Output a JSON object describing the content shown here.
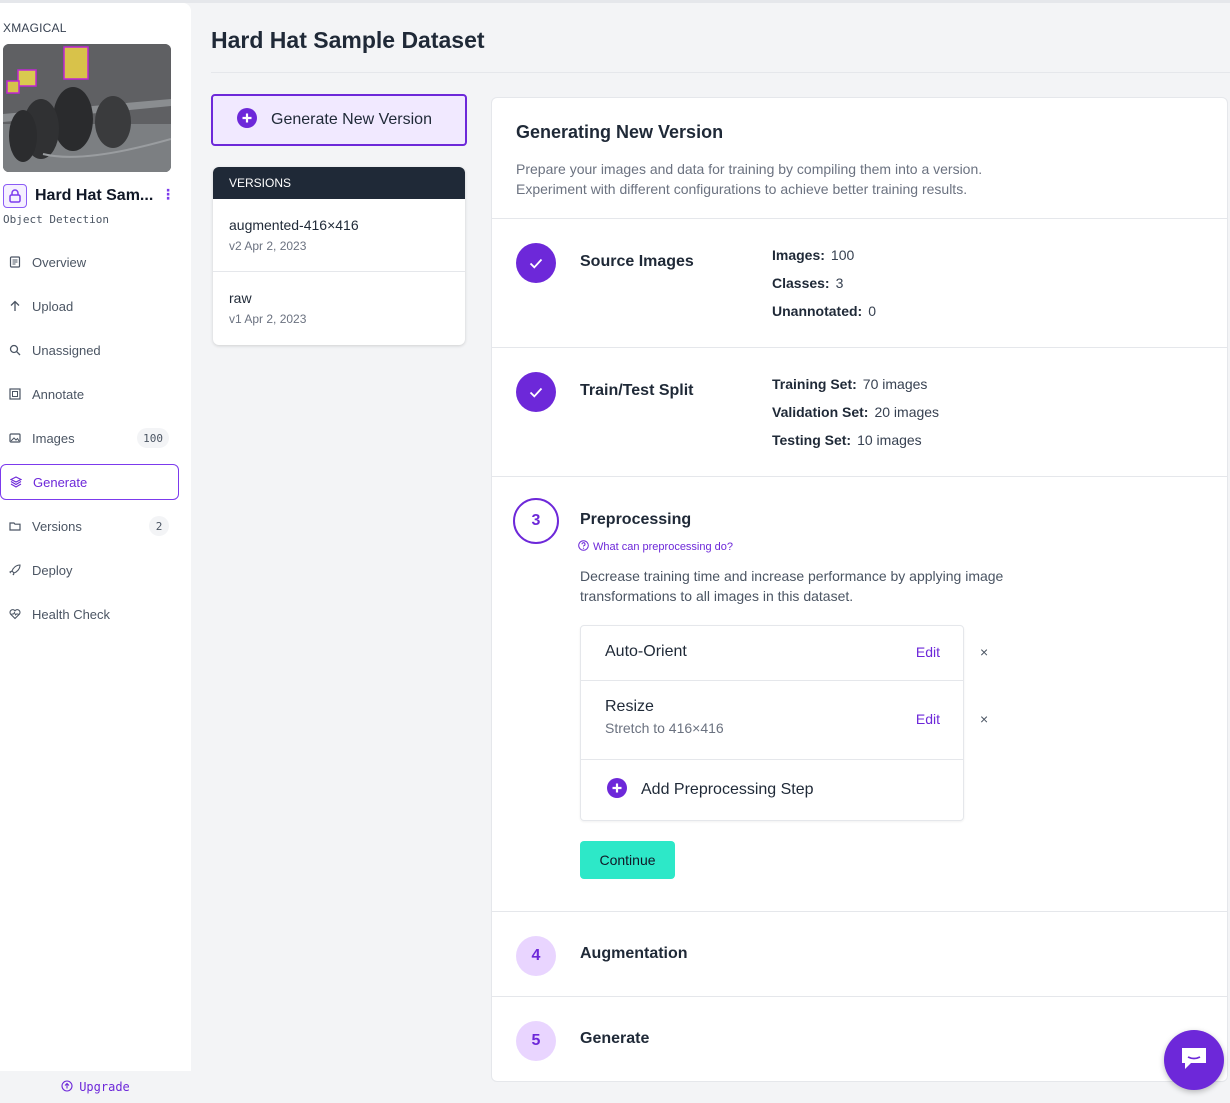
{
  "sidebar": {
    "workspace": "XMAGICAL",
    "project_name": "Hard Hat Sam...",
    "project_type": "Object Detection",
    "items": [
      {
        "label": "Overview",
        "icon": "document-icon"
      },
      {
        "label": "Upload",
        "icon": "arrow-up-icon"
      },
      {
        "label": "Unassigned",
        "icon": "search-icon"
      },
      {
        "label": "Annotate",
        "icon": "annotate-icon"
      },
      {
        "label": "Images",
        "icon": "images-icon",
        "badge": "100"
      },
      {
        "label": "Generate",
        "icon": "generate-icon",
        "active": true
      },
      {
        "label": "Versions",
        "icon": "versions-icon",
        "badge": "2"
      },
      {
        "label": "Deploy",
        "icon": "rocket-icon"
      },
      {
        "label": "Health Check",
        "icon": "heart-pulse-icon"
      }
    ],
    "upgrade_label": "Upgrade"
  },
  "header": {
    "title": "Hard Hat Sample Dataset"
  },
  "generate_button": {
    "label": "Generate New Version"
  },
  "versions": {
    "heading": "VERSIONS",
    "items": [
      {
        "name": "augmented-416×416",
        "meta": "v2 Apr 2, 2023"
      },
      {
        "name": "raw",
        "meta": "v1 Apr 2, 2023"
      }
    ]
  },
  "panel": {
    "title": "Generating New Version",
    "description_line1": "Prepare your images and data for training by compiling them into a version.",
    "description_line2": "Experiment with different configurations to achieve better training results."
  },
  "steps": {
    "source": {
      "title": "Source Images",
      "stats": [
        {
          "label": "Images:",
          "value": "100"
        },
        {
          "label": "Classes:",
          "value": "3"
        },
        {
          "label": "Unannotated:",
          "value": "0"
        }
      ]
    },
    "split": {
      "title": "Train/Test Split",
      "stats": [
        {
          "label": "Training Set:",
          "value": "70 images"
        },
        {
          "label": "Validation Set:",
          "value": "20 images"
        },
        {
          "label": "Testing Set:",
          "value": "10 images"
        }
      ]
    },
    "preprocessing": {
      "number": "3",
      "title": "Preprocessing",
      "help_link": "What can preprocessing do?",
      "description": "Decrease training time and increase performance by applying image transformations to all images in this dataset.",
      "rows": [
        {
          "name": "Auto-Orient",
          "sub": "",
          "edit": "Edit",
          "remove": "×"
        },
        {
          "name": "Resize",
          "sub": "Stretch to 416×416",
          "edit": "Edit",
          "remove": "×"
        }
      ],
      "add_label": "Add Preprocessing Step",
      "continue_label": "Continue"
    },
    "augmentation": {
      "number": "4",
      "title": "Augmentation"
    },
    "generate": {
      "number": "5",
      "title": "Generate"
    }
  },
  "colors": {
    "accent": "#6d28d9",
    "continue": "#2de8c8",
    "dark_header": "#1f2937"
  }
}
